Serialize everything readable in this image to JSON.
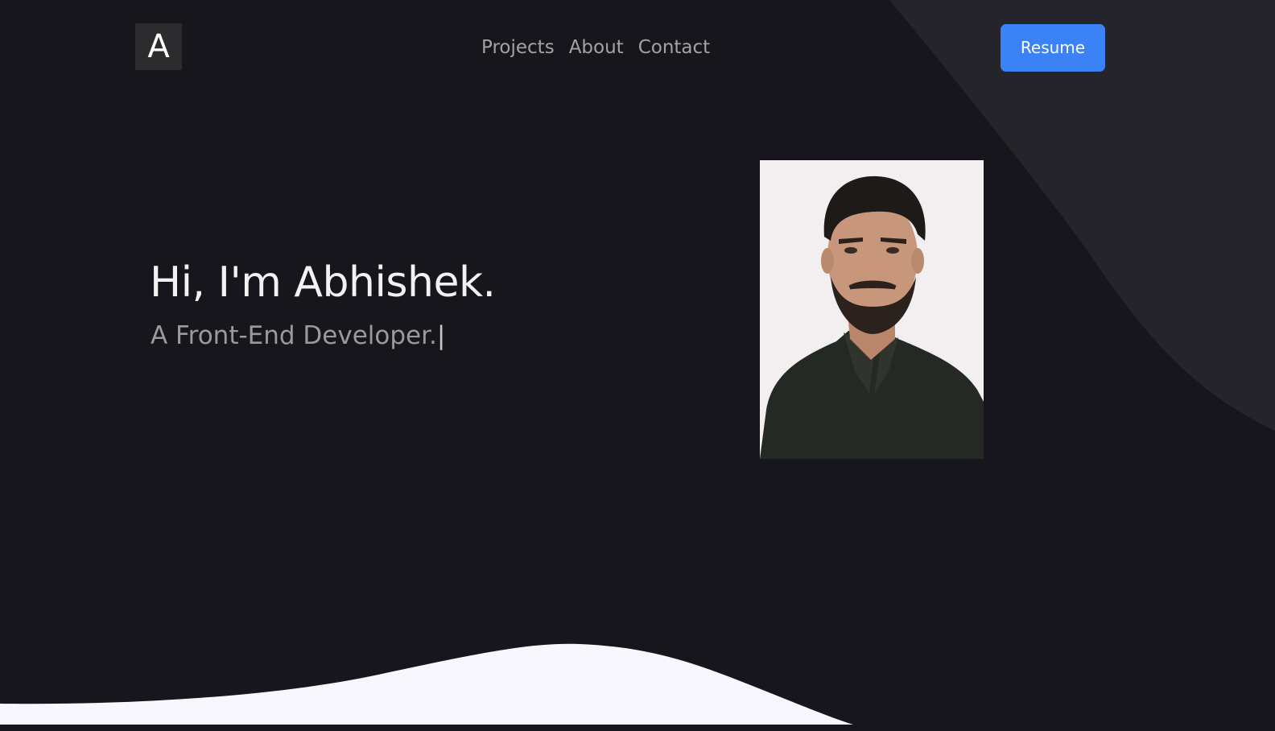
{
  "header": {
    "logo_letter": "A",
    "nav": [
      {
        "label": "Projects"
      },
      {
        "label": "About"
      },
      {
        "label": "Contact"
      }
    ],
    "resume_label": "Resume"
  },
  "hero": {
    "greeting": "Hi, I'm Abhishek.",
    "subtitle": "A Front-End Developer.",
    "cursor": "|"
  },
  "colors": {
    "background": "#17161c",
    "accent": "#3b82f6",
    "decor_shape": "#25242b",
    "bottom_wave": "#f8f7fd"
  }
}
